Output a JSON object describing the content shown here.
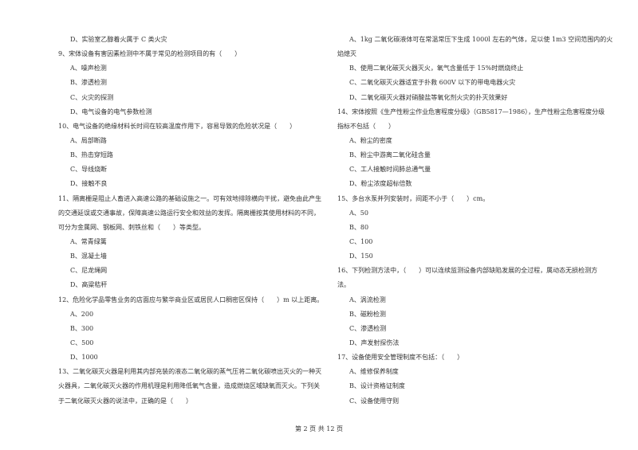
{
  "left": [
    {
      "type": "opt",
      "text": "D、实验室乙醇着火属于 C 类火灾"
    },
    {
      "type": "q",
      "text": "9、宋体设备有害因素检测中不属于常见的检测项目的有（　　）"
    },
    {
      "type": "opt",
      "text": "A、噪声检测"
    },
    {
      "type": "opt",
      "text": "B、渗透检测"
    },
    {
      "type": "opt",
      "text": "C、火灾的探测"
    },
    {
      "type": "opt",
      "text": "D、电气设备的电气参数检测"
    },
    {
      "type": "q",
      "text": "10、电气设备的绝缘材料长时间在较高温度作用下，容易导致的危险状况是（　　）"
    },
    {
      "type": "opt",
      "text": "A、局部断路"
    },
    {
      "type": "opt",
      "text": "B、热击穿短路"
    },
    {
      "type": "opt",
      "text": "C、导线烧断"
    },
    {
      "type": "opt",
      "text": "D、接触不良"
    },
    {
      "type": "q",
      "text": "11、隔离栅是阻止人畜进入高速公路的基础设施之一。可有效地排除横向干扰，避免由此产生"
    },
    {
      "type": "q",
      "text": "的交通延误或交通事故，保障高速公路运行安全和效益的发挥。隔离栅按其使用材料的不同，"
    },
    {
      "type": "q",
      "text": "可分为金属网、钢板网、刺铁丝和（　　）等类型。"
    },
    {
      "type": "opt",
      "text": "A、常青绿篱"
    },
    {
      "type": "opt",
      "text": "B、混凝土墙"
    },
    {
      "type": "opt",
      "text": "C、尼龙绳网"
    },
    {
      "type": "opt",
      "text": "D、高粱秸秆"
    },
    {
      "type": "q",
      "text": "12、危险化学品零售业务的店面应与繁华商业区或居民人口稠密区保持（　　）m 以上距离。"
    },
    {
      "type": "opt",
      "text": "A、200"
    },
    {
      "type": "opt",
      "text": "B、300"
    },
    {
      "type": "opt",
      "text": "C、500"
    },
    {
      "type": "opt",
      "text": "D、1000"
    },
    {
      "type": "q",
      "text": "13、二氧化碳灭火器是利用其内部充装的液态二氧化碳的蒸气压将二氧化碳喷出灭火的一种灭"
    },
    {
      "type": "q",
      "text": "火器具，二氧化碳灭火器的作用机理是利用降低氧气含量，造成燃烧区域缺氧而灭火。下列关"
    },
    {
      "type": "q",
      "text": "于二氧化碳灭火器的说法中，正确的是（　　）"
    }
  ],
  "right": [
    {
      "type": "opt",
      "text": "A、1kg 二氧化碳液体可在常温常压下生成 1000l 左右的气体，足以使 1m3 空间范围内的火"
    },
    {
      "type": "q",
      "text": "焰熄灭"
    },
    {
      "type": "opt",
      "text": "B、使用二氧化碳灭火器灭火，氧气含量低于 15%时燃烧终止"
    },
    {
      "type": "opt",
      "text": "C、二氧化碳灭火器适宜于扑救 600V 以下的带电电器火灾"
    },
    {
      "type": "opt",
      "text": "D、二氧化碳灭火器对硝酸盐等氧化剂火灾的扑灭效果好"
    },
    {
      "type": "q",
      "text": "14、宋体按照《生产性粉尘作业危害程度分级》（GB5817—1986），生产性粉尘危害程度分级"
    },
    {
      "type": "q",
      "text": "指标不包括（　　）"
    },
    {
      "type": "opt",
      "text": "A、粉尘的密度"
    },
    {
      "type": "opt",
      "text": "B、粉尘中游离二氧化硅含量"
    },
    {
      "type": "opt",
      "text": "C、工人接触时间肺总通气量"
    },
    {
      "type": "opt",
      "text": "D、粉尘浓度超标倍数"
    },
    {
      "type": "q",
      "text": "15、多台水泵并列安装时，间距不小于（　　）cm。"
    },
    {
      "type": "opt",
      "text": "A、50"
    },
    {
      "type": "opt",
      "text": "B、80"
    },
    {
      "type": "opt",
      "text": "C、100"
    },
    {
      "type": "opt",
      "text": "D、150"
    },
    {
      "type": "q",
      "text": "16、下列检测方法中，（　　）可以连续监测设备内部缺陷发展的全过程，属动态无损检测方"
    },
    {
      "type": "q",
      "text": "法。"
    },
    {
      "type": "opt",
      "text": "A、涡流检测"
    },
    {
      "type": "opt",
      "text": "B、磁粉检测"
    },
    {
      "type": "opt",
      "text": "C、渗透检测"
    },
    {
      "type": "opt",
      "text": "D、声发射探伤法"
    },
    {
      "type": "q",
      "text": "17、设备使用安全管理制度不包括：（　　）"
    },
    {
      "type": "opt",
      "text": "A、维修保养制度"
    },
    {
      "type": "opt",
      "text": "B、设计资格证制度"
    },
    {
      "type": "opt",
      "text": "C、设备使用守则"
    }
  ],
  "footer": "第 2 页 共 12 页"
}
